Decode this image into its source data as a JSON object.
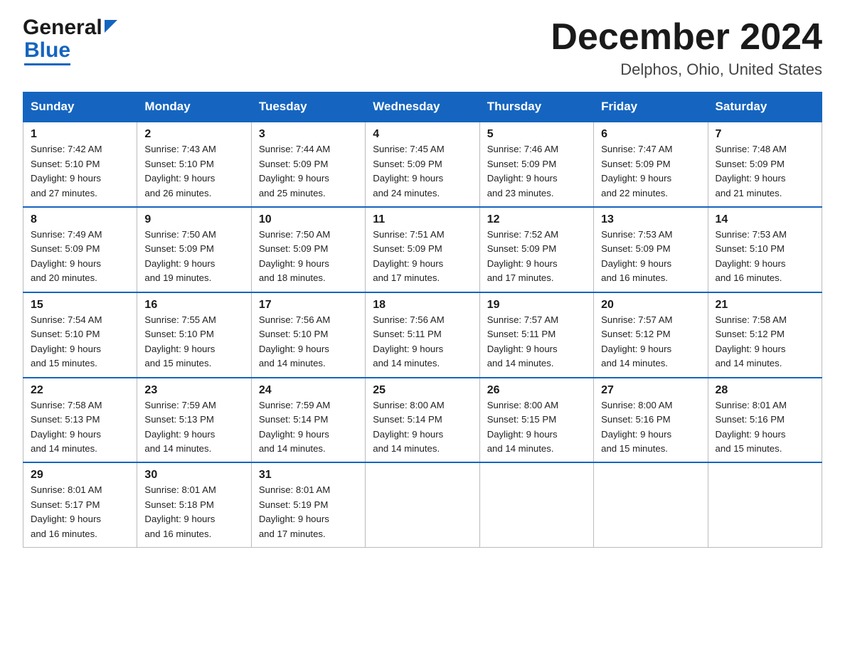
{
  "header": {
    "logo_general": "General",
    "logo_blue": "Blue",
    "month_year": "December 2024",
    "location": "Delphos, Ohio, United States"
  },
  "days_of_week": [
    "Sunday",
    "Monday",
    "Tuesday",
    "Wednesday",
    "Thursday",
    "Friday",
    "Saturday"
  ],
  "weeks": [
    [
      {
        "day": "1",
        "sunrise": "7:42 AM",
        "sunset": "5:10 PM",
        "daylight": "9 hours and 27 minutes."
      },
      {
        "day": "2",
        "sunrise": "7:43 AM",
        "sunset": "5:10 PM",
        "daylight": "9 hours and 26 minutes."
      },
      {
        "day": "3",
        "sunrise": "7:44 AM",
        "sunset": "5:09 PM",
        "daylight": "9 hours and 25 minutes."
      },
      {
        "day": "4",
        "sunrise": "7:45 AM",
        "sunset": "5:09 PM",
        "daylight": "9 hours and 24 minutes."
      },
      {
        "day": "5",
        "sunrise": "7:46 AM",
        "sunset": "5:09 PM",
        "daylight": "9 hours and 23 minutes."
      },
      {
        "day": "6",
        "sunrise": "7:47 AM",
        "sunset": "5:09 PM",
        "daylight": "9 hours and 22 minutes."
      },
      {
        "day": "7",
        "sunrise": "7:48 AM",
        "sunset": "5:09 PM",
        "daylight": "9 hours and 21 minutes."
      }
    ],
    [
      {
        "day": "8",
        "sunrise": "7:49 AM",
        "sunset": "5:09 PM",
        "daylight": "9 hours and 20 minutes."
      },
      {
        "day": "9",
        "sunrise": "7:50 AM",
        "sunset": "5:09 PM",
        "daylight": "9 hours and 19 minutes."
      },
      {
        "day": "10",
        "sunrise": "7:50 AM",
        "sunset": "5:09 PM",
        "daylight": "9 hours and 18 minutes."
      },
      {
        "day": "11",
        "sunrise": "7:51 AM",
        "sunset": "5:09 PM",
        "daylight": "9 hours and 17 minutes."
      },
      {
        "day": "12",
        "sunrise": "7:52 AM",
        "sunset": "5:09 PM",
        "daylight": "9 hours and 17 minutes."
      },
      {
        "day": "13",
        "sunrise": "7:53 AM",
        "sunset": "5:09 PM",
        "daylight": "9 hours and 16 minutes."
      },
      {
        "day": "14",
        "sunrise": "7:53 AM",
        "sunset": "5:10 PM",
        "daylight": "9 hours and 16 minutes."
      }
    ],
    [
      {
        "day": "15",
        "sunrise": "7:54 AM",
        "sunset": "5:10 PM",
        "daylight": "9 hours and 15 minutes."
      },
      {
        "day": "16",
        "sunrise": "7:55 AM",
        "sunset": "5:10 PM",
        "daylight": "9 hours and 15 minutes."
      },
      {
        "day": "17",
        "sunrise": "7:56 AM",
        "sunset": "5:10 PM",
        "daylight": "9 hours and 14 minutes."
      },
      {
        "day": "18",
        "sunrise": "7:56 AM",
        "sunset": "5:11 PM",
        "daylight": "9 hours and 14 minutes."
      },
      {
        "day": "19",
        "sunrise": "7:57 AM",
        "sunset": "5:11 PM",
        "daylight": "9 hours and 14 minutes."
      },
      {
        "day": "20",
        "sunrise": "7:57 AM",
        "sunset": "5:12 PM",
        "daylight": "9 hours and 14 minutes."
      },
      {
        "day": "21",
        "sunrise": "7:58 AM",
        "sunset": "5:12 PM",
        "daylight": "9 hours and 14 minutes."
      }
    ],
    [
      {
        "day": "22",
        "sunrise": "7:58 AM",
        "sunset": "5:13 PM",
        "daylight": "9 hours and 14 minutes."
      },
      {
        "day": "23",
        "sunrise": "7:59 AM",
        "sunset": "5:13 PM",
        "daylight": "9 hours and 14 minutes."
      },
      {
        "day": "24",
        "sunrise": "7:59 AM",
        "sunset": "5:14 PM",
        "daylight": "9 hours and 14 minutes."
      },
      {
        "day": "25",
        "sunrise": "8:00 AM",
        "sunset": "5:14 PM",
        "daylight": "9 hours and 14 minutes."
      },
      {
        "day": "26",
        "sunrise": "8:00 AM",
        "sunset": "5:15 PM",
        "daylight": "9 hours and 14 minutes."
      },
      {
        "day": "27",
        "sunrise": "8:00 AM",
        "sunset": "5:16 PM",
        "daylight": "9 hours and 15 minutes."
      },
      {
        "day": "28",
        "sunrise": "8:01 AM",
        "sunset": "5:16 PM",
        "daylight": "9 hours and 15 minutes."
      }
    ],
    [
      {
        "day": "29",
        "sunrise": "8:01 AM",
        "sunset": "5:17 PM",
        "daylight": "9 hours and 16 minutes."
      },
      {
        "day": "30",
        "sunrise": "8:01 AM",
        "sunset": "5:18 PM",
        "daylight": "9 hours and 16 minutes."
      },
      {
        "day": "31",
        "sunrise": "8:01 AM",
        "sunset": "5:19 PM",
        "daylight": "9 hours and 17 minutes."
      },
      null,
      null,
      null,
      null
    ]
  ],
  "labels": {
    "sunrise": "Sunrise:",
    "sunset": "Sunset:",
    "daylight": "Daylight:"
  }
}
